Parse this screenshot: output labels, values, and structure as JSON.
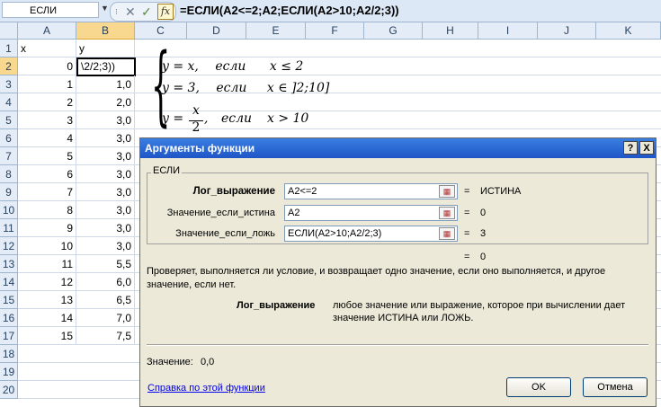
{
  "formula_bar": {
    "name_box": "ЕСЛИ",
    "cancel_glyph": "✕",
    "enter_glyph": "✓",
    "fx_label": "fx",
    "formula": "=ЕСЛИ(A2<=2;A2;ЕСЛИ(A2>10;A2/2;3))"
  },
  "sheet": {
    "columns": [
      "A",
      "B",
      "C",
      "D",
      "E",
      "F",
      "G",
      "H",
      "I",
      "J",
      "K"
    ],
    "selected_column": "B",
    "rows": [
      "1",
      "2",
      "3",
      "4",
      "5",
      "6",
      "7",
      "8",
      "9",
      "10",
      "11",
      "12",
      "13",
      "14",
      "15",
      "16",
      "17",
      "18",
      "19",
      "20"
    ],
    "selected_row": "2",
    "header_row": {
      "a": "x",
      "b": "y"
    },
    "edit_cell_text": "\\2/2;3))",
    "data": [
      {
        "a": "0",
        "b": ""
      },
      {
        "a": "1",
        "b": "1,0"
      },
      {
        "a": "2",
        "b": "2,0"
      },
      {
        "a": "3",
        "b": "3,0"
      },
      {
        "a": "4",
        "b": "3,0"
      },
      {
        "a": "5",
        "b": "3,0"
      },
      {
        "a": "6",
        "b": "3,0"
      },
      {
        "a": "7",
        "b": "3,0"
      },
      {
        "a": "8",
        "b": "3,0"
      },
      {
        "a": "9",
        "b": "3,0"
      },
      {
        "a": "10",
        "b": "3,0"
      },
      {
        "a": "11",
        "b": "5,5"
      },
      {
        "a": "12",
        "b": "6,0"
      },
      {
        "a": "13",
        "b": "6,5"
      },
      {
        "a": "14",
        "b": "7,0"
      },
      {
        "a": "15",
        "b": "7,5"
      }
    ]
  },
  "equation": {
    "line1": {
      "lhs": "y = x,",
      "word": "если",
      "cond": "x ≤ 2"
    },
    "line2": {
      "lhs": "y = 3,",
      "word": "если",
      "cond": "x ∈ ]2;10]"
    },
    "line3": {
      "lhs_y": "y =",
      "num": "x",
      "den": "2",
      "comma": ",",
      "word": "если",
      "cond": "x > 10"
    }
  },
  "dialog": {
    "title": "Аргументы функции",
    "help_btn": "?",
    "close_btn": "X",
    "function_name": "ЕСЛИ",
    "args": [
      {
        "name": "Лог_выражение",
        "value": "A2<=2",
        "eq": "=",
        "result": "ИСТИНА"
      },
      {
        "name": "Значение_если_истина",
        "value": "A2",
        "eq": "=",
        "result": "0"
      },
      {
        "name": "Значение_если_ложь",
        "value": "ЕСЛИ(A2>10;A2/2;3)",
        "eq": "=",
        "result": "3"
      }
    ],
    "total_eq": "=",
    "total_result": "0",
    "description_line1": "Проверяет, выполняется ли условие, и возвращает одно значение, если оно выполняется, и другое",
    "description_line2": "значение, если нет.",
    "arg_help_name": "Лог_выражение",
    "arg_help_line1": "любое значение или выражение, которое при вычислении дает",
    "arg_help_line2": "значение ИСТИНА или ЛОЖЬ.",
    "value_label": "Значение:",
    "value": "0,0",
    "help_link": "Справка по этой функции",
    "ok": "OK",
    "cancel": "Отмена"
  }
}
